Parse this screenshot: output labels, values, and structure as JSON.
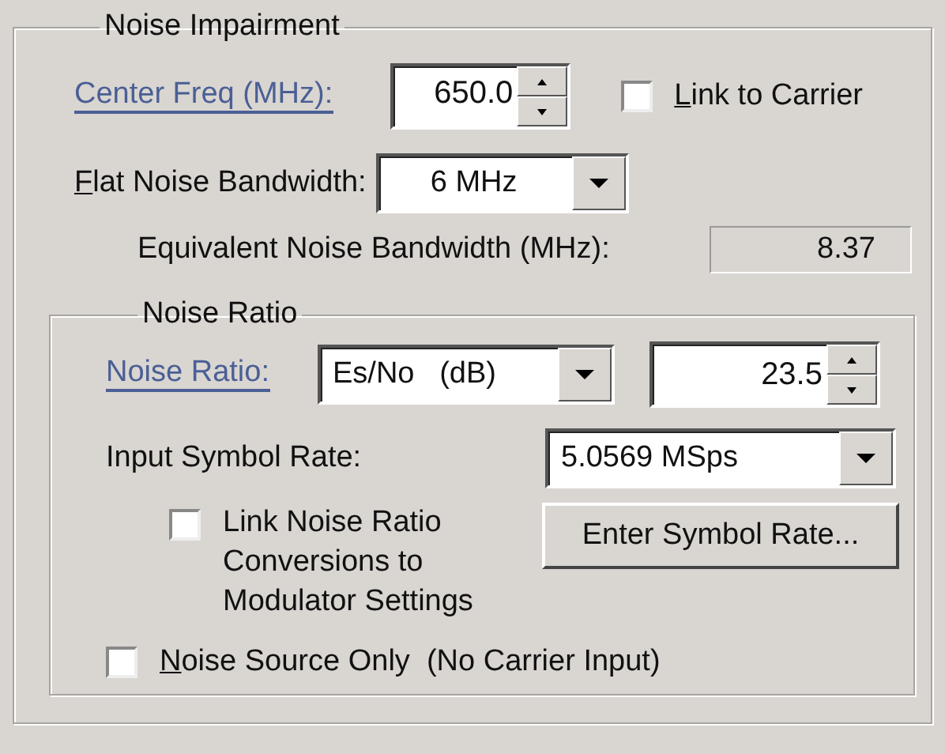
{
  "group": {
    "title": "Noise Impairment"
  },
  "center_freq": {
    "label": "Center Freq (MHz):",
    "value": "650.0"
  },
  "link_to_carrier": {
    "label": "Link to Carrier",
    "checked": false
  },
  "flat_noise_bandwidth": {
    "label": "Flat Noise Bandwidth:",
    "value": "6 MHz"
  },
  "equivalent_noise_bandwidth": {
    "label": "Equivalent Noise Bandwidth (MHz):",
    "value": "8.37"
  },
  "noise_ratio_group": {
    "title": "Noise Ratio",
    "noise_ratio": {
      "label": "Noise Ratio:",
      "type": "Es/No   (dB)",
      "value": "23.5"
    },
    "input_symbol_rate": {
      "label": "Input Symbol Rate:",
      "value": "5.0569 MSps"
    },
    "link_conversions": {
      "label": "Link Noise Ratio Conversions to Modulator Settings",
      "checked": false
    },
    "enter_symbol_rate_button": "Enter Symbol Rate...",
    "noise_source_only": {
      "label": "Noise Source Only  (No Carrier Input)",
      "checked": false
    }
  }
}
